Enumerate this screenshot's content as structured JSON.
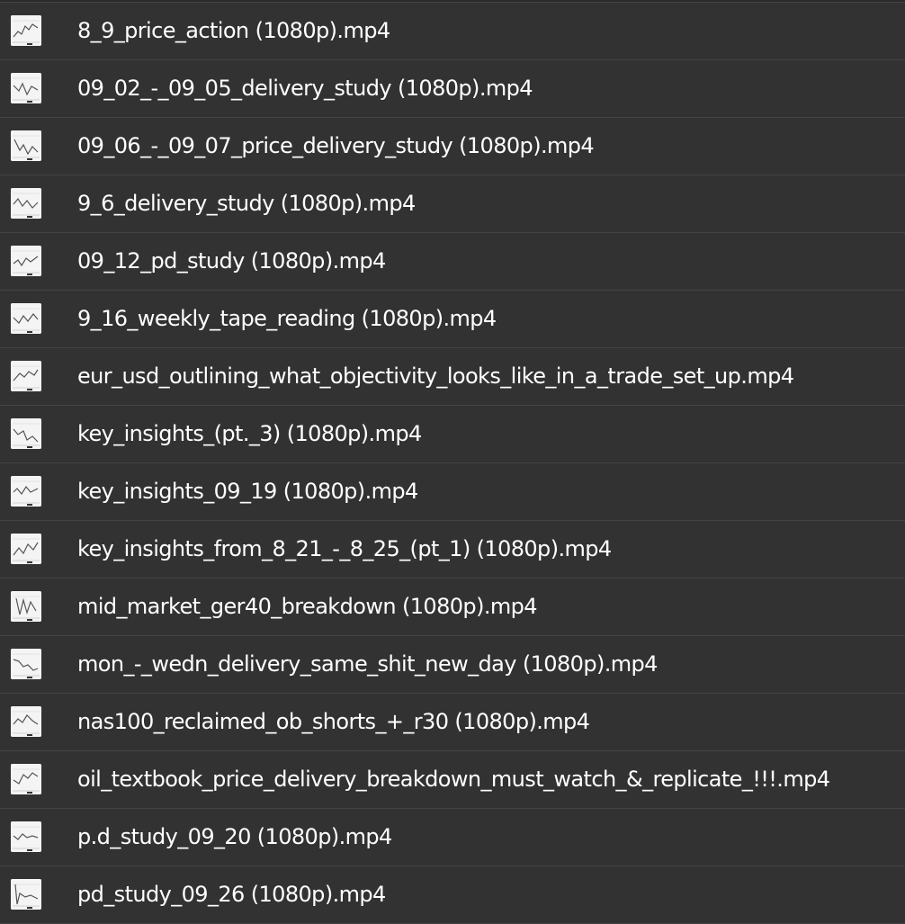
{
  "files": [
    {
      "name": "8_9_price_action (1080p).mp4",
      "icon": "video-thumbnail-icon"
    },
    {
      "name": "09_02_-_09_05_delivery_study (1080p).mp4",
      "icon": "video-thumbnail-icon"
    },
    {
      "name": "09_06_-_09_07_price_delivery_study (1080p).mp4",
      "icon": "video-thumbnail-icon"
    },
    {
      "name": "9_6_delivery_study (1080p).mp4",
      "icon": "video-thumbnail-icon"
    },
    {
      "name": "09_12_pd_study (1080p).mp4",
      "icon": "video-thumbnail-icon"
    },
    {
      "name": "9_16_weekly_tape_reading (1080p).mp4",
      "icon": "video-thumbnail-icon"
    },
    {
      "name": "eur_usd_outlining_what_objectivity_looks_like_in_a_trade_set_up.mp4",
      "icon": "video-thumbnail-icon"
    },
    {
      "name": "key_insights_(pt._3) (1080p).mp4",
      "icon": "video-thumbnail-icon"
    },
    {
      "name": "key_insights_09_19 (1080p).mp4",
      "icon": "video-thumbnail-icon"
    },
    {
      "name": "key_insights_from_8_21_-_8_25_(pt_1) (1080p).mp4",
      "icon": "video-thumbnail-icon"
    },
    {
      "name": "mid_market_ger40_breakdown (1080p).mp4",
      "icon": "video-thumbnail-icon"
    },
    {
      "name": "mon_-_wedn_delivery_same_shit_new_day (1080p).mp4",
      "icon": "video-thumbnail-icon"
    },
    {
      "name": "nas100_reclaimed_ob_shorts_+_r30 (1080p).mp4",
      "icon": "video-thumbnail-icon"
    },
    {
      "name": "oil_textbook_price_delivery_breakdown_must_watch_&_replicate_!!!.mp4",
      "icon": "video-thumbnail-icon"
    },
    {
      "name": "p.d_study_09_20 (1080p).mp4",
      "icon": "video-thumbnail-icon"
    },
    {
      "name": "pd_study_09_26 (1080p).mp4",
      "icon": "video-thumbnail-icon"
    }
  ],
  "colors": {
    "background": "#2b2b2b",
    "row": "#323232",
    "divider": "#444444",
    "text": "#ffffff",
    "thumbnail": "#f4f4f4"
  }
}
